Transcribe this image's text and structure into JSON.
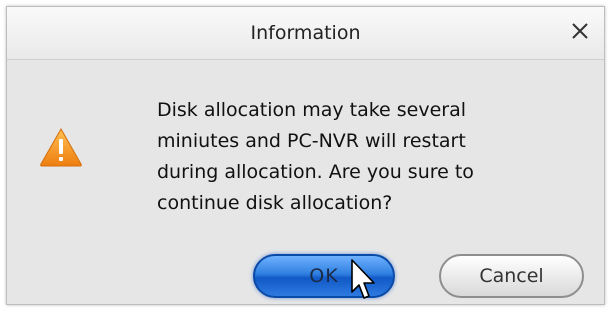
{
  "dialog": {
    "title": "Information",
    "close_glyph": "✕",
    "message": "Disk allocation may take several\nminiutes and PC-NVR will restart\nduring allocation. Are you sure to\ncontinue disk allocation?",
    "icon": "warning-icon",
    "buttons": {
      "ok_label": "OK",
      "cancel_label": "Cancel"
    }
  },
  "colors": {
    "warning": "#f29a1f",
    "ok_button": "#2f7fe0"
  }
}
